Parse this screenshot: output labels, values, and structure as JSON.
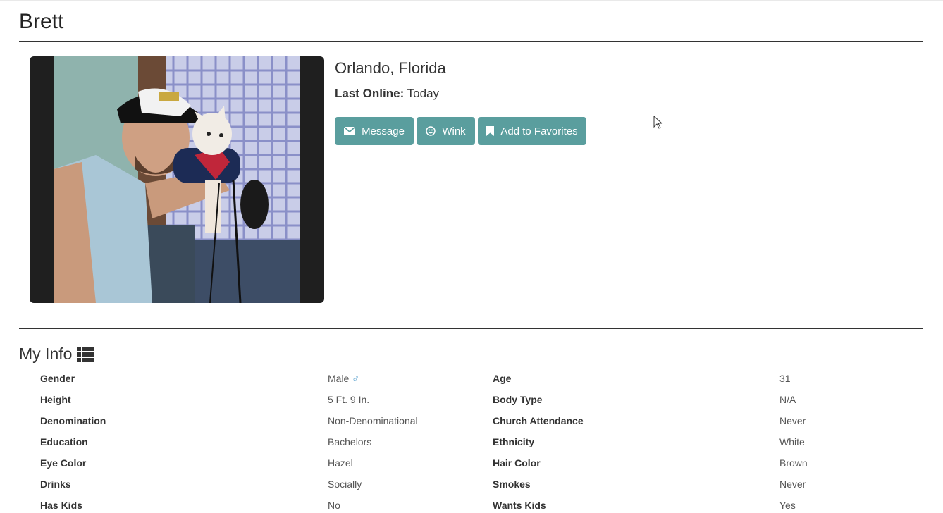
{
  "profile": {
    "name": "Brett",
    "location": "Orlando, Florida",
    "last_online_label": "Last Online:",
    "last_online_value": "Today"
  },
  "actions": {
    "message_label": "Message",
    "wink_label": "Wink",
    "favorites_label": "Add to Favorites",
    "button_color": "#5a9e9e"
  },
  "info": {
    "title": "My Info",
    "icon": "list-icon",
    "rows": [
      {
        "l1": "Gender",
        "v1": "Male",
        "l2": "Age",
        "v2": "31"
      },
      {
        "l1": "Height",
        "v1": "5 Ft. 9 In.",
        "l2": "Body Type",
        "v2": "N/A"
      },
      {
        "l1": "Denomination",
        "v1": "Non-Denominational",
        "l2": "Church Attendance",
        "v2": "Never"
      },
      {
        "l1": "Education",
        "v1": "Bachelors",
        "l2": "Ethnicity",
        "v2": "White"
      },
      {
        "l1": "Eye Color",
        "v1": "Hazel",
        "l2": "Hair Color",
        "v2": "Brown"
      },
      {
        "l1": "Drinks",
        "v1": "Socially",
        "l2": "Smokes",
        "v2": "Never"
      },
      {
        "l1": "Has Kids",
        "v1": "No",
        "l2": "Wants Kids",
        "v2": "Yes"
      }
    ],
    "gender_symbol": "♂",
    "gender_symbol_color": "#3a8fc4"
  }
}
